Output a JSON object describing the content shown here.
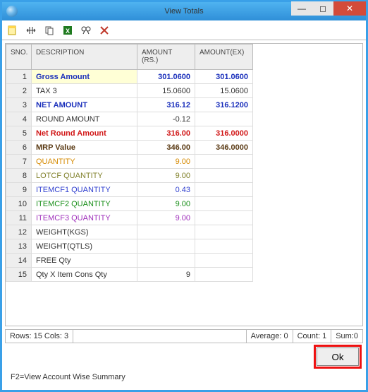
{
  "window": {
    "title": "View Totals",
    "btn_min": "—",
    "btn_max": "◻",
    "btn_close": "✕"
  },
  "table": {
    "headers": {
      "sno": "SNO.",
      "desc": "DESCRIPTION",
      "amt": "AMOUNT (RS.)",
      "amtex": "AMOUNT(EX)"
    },
    "rows": [
      {
        "sno": "1",
        "desc": "Gross Amount",
        "amt": "301.0600",
        "amtex": "301.0600",
        "color": "#1a2fbb",
        "bold": true,
        "hl": true
      },
      {
        "sno": "2",
        "desc": "TAX 3",
        "amt": "15.0600",
        "amtex": "15.0600",
        "color": "#333"
      },
      {
        "sno": "3",
        "desc": "NET AMOUNT",
        "amt": "316.12",
        "amtex": "316.1200",
        "color": "#1a2fbb",
        "bold": true
      },
      {
        "sno": "4",
        "desc": "ROUND AMOUNT",
        "amt": "-0.12",
        "amtex": "",
        "color": "#333"
      },
      {
        "sno": "5",
        "desc": "Net Round Amount",
        "amt": "316.00",
        "amtex": "316.0000",
        "color": "#d11717",
        "bold": true
      },
      {
        "sno": "6",
        "desc": "MRP Value",
        "amt": "346.00",
        "amtex": "346.0000",
        "color": "#5a3a14",
        "bold": true
      },
      {
        "sno": "7",
        "desc": "QUANTITY",
        "amt": "9.00",
        "amtex": "",
        "color": "#d68a00"
      },
      {
        "sno": "8",
        "desc": "LOTCF    QUANTITY",
        "amt": "9.00",
        "amtex": "",
        "color": "#80802a"
      },
      {
        "sno": "9",
        "desc": "ITEMCF1   QUANTITY",
        "amt": "0.43",
        "amtex": "",
        "color": "#2f3fcf"
      },
      {
        "sno": "10",
        "desc": "ITEMCF2   QUANTITY",
        "amt": "9.00",
        "amtex": "",
        "color": "#1a8f1a"
      },
      {
        "sno": "11",
        "desc": "ITEMCF3    QUANTITY",
        "amt": "9.00",
        "amtex": "",
        "color": "#9f2fbb"
      },
      {
        "sno": "12",
        "desc": "WEIGHT(KGS)",
        "amt": "",
        "amtex": "",
        "color": "#333"
      },
      {
        "sno": "13",
        "desc": "WEIGHT(QTLS)",
        "amt": "",
        "amtex": "",
        "color": "#333"
      },
      {
        "sno": "14",
        "desc": "FREE Qty",
        "amt": "",
        "amtex": "",
        "color": "#333"
      },
      {
        "sno": "15",
        "desc": "Qty X Item Cons Qty",
        "amt": "9",
        "amtex": "",
        "color": "#333"
      }
    ]
  },
  "status": {
    "rowscols": "Rows: 15  Cols: 3",
    "avg": "Average: 0",
    "count": "Count: 1",
    "sum": "Sum:0"
  },
  "buttons": {
    "ok": "Ok"
  },
  "hint": "F2=View Account Wise Summary"
}
